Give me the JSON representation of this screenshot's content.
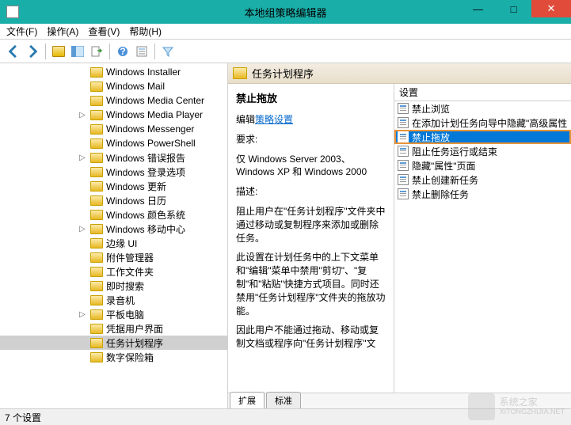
{
  "window": {
    "title": "本地组策略编辑器",
    "min": "—",
    "max": "□",
    "close": "✕"
  },
  "menubar": {
    "file": "文件(F)",
    "action": "操作(A)",
    "view": "查看(V)",
    "help": "帮助(H)"
  },
  "tree": {
    "items": [
      {
        "indent": 110,
        "expander": "",
        "label": "Windows Installer"
      },
      {
        "indent": 110,
        "expander": "",
        "label": "Windows Mail"
      },
      {
        "indent": 110,
        "expander": "",
        "label": "Windows Media Center"
      },
      {
        "indent": 98,
        "expander": "▷",
        "label": "Windows Media Player"
      },
      {
        "indent": 110,
        "expander": "",
        "label": "Windows Messenger"
      },
      {
        "indent": 110,
        "expander": "",
        "label": "Windows PowerShell"
      },
      {
        "indent": 98,
        "expander": "▷",
        "label": "Windows 错误报告"
      },
      {
        "indent": 110,
        "expander": "",
        "label": "Windows 登录选项"
      },
      {
        "indent": 110,
        "expander": "",
        "label": "Windows 更新"
      },
      {
        "indent": 110,
        "expander": "",
        "label": "Windows 日历"
      },
      {
        "indent": 110,
        "expander": "",
        "label": "Windows 颜色系统"
      },
      {
        "indent": 98,
        "expander": "▷",
        "label": "Windows 移动中心"
      },
      {
        "indent": 110,
        "expander": "",
        "label": "边缘 UI"
      },
      {
        "indent": 110,
        "expander": "",
        "label": "附件管理器"
      },
      {
        "indent": 110,
        "expander": "",
        "label": "工作文件夹"
      },
      {
        "indent": 110,
        "expander": "",
        "label": "即时搜索"
      },
      {
        "indent": 110,
        "expander": "",
        "label": "录音机"
      },
      {
        "indent": 98,
        "expander": "▷",
        "label": "平板电脑"
      },
      {
        "indent": 110,
        "expander": "",
        "label": "凭据用户界面"
      },
      {
        "indent": 110,
        "expander": "",
        "label": "任务计划程序",
        "selected": true
      },
      {
        "indent": 110,
        "expander": "",
        "label": "数字保险箱"
      }
    ]
  },
  "right_header": {
    "title": "任务计划程序"
  },
  "detail": {
    "heading": "禁止拖放",
    "edit_prefix": "编辑",
    "edit_link": "策略设置",
    "req_label": "要求:",
    "req_text": "仅 Windows Server 2003、Windows XP 和 Windows 2000",
    "desc_label": "描述:",
    "desc1": "阻止用户在\"任务计划程序\"文件夹中通过移动或复制程序来添加或删除任务。",
    "desc2": "此设置在计划任务中的上下文菜单和\"编辑\"菜单中禁用\"剪切\"、\"复制\"和\"粘贴\"快捷方式项目。同时还禁用\"任务计划程序\"文件夹的拖放功能。",
    "desc3": "因此用户不能通过拖动、移动或复制文档或程序向\"任务计划程序\"文"
  },
  "settings": {
    "header": "设置",
    "items": [
      {
        "label": "禁止浏览"
      },
      {
        "label": "在添加计划任务向导中隐藏\"高级属性"
      },
      {
        "label": "禁止拖放",
        "selected": true,
        "highlighted": true
      },
      {
        "label": "阻止任务运行或结束"
      },
      {
        "label": "隐藏\"属性\"页面"
      },
      {
        "label": "禁止创建新任务"
      },
      {
        "label": "禁止删除任务"
      }
    ]
  },
  "tabs": {
    "extended": "扩展",
    "standard": "标准"
  },
  "statusbar": {
    "text": "7 个设置"
  },
  "watermark": {
    "line1": "系统之家",
    "line2": "XITONGZHIJIA.NET"
  }
}
